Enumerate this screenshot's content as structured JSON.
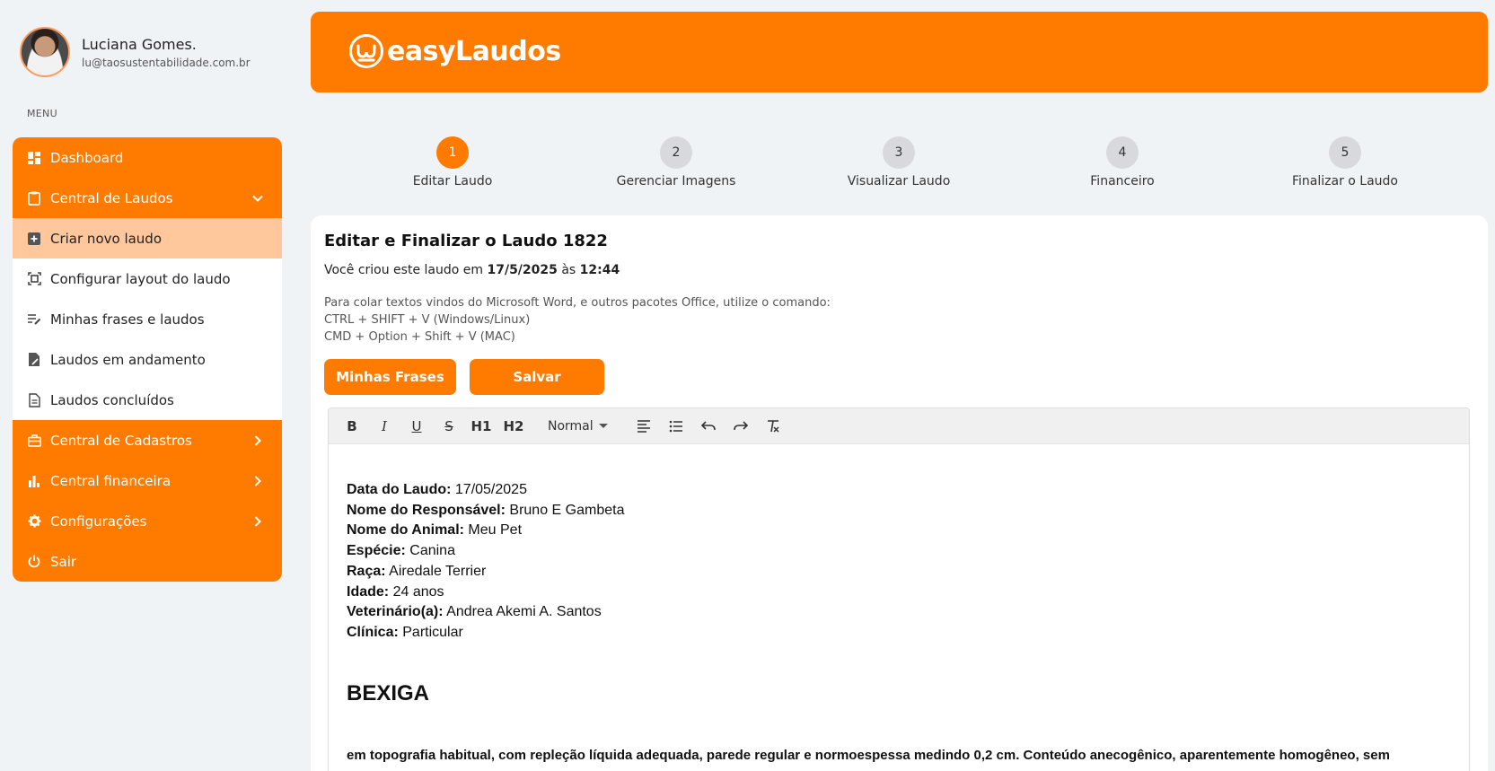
{
  "profile": {
    "name": "Luciana Gomes.",
    "email": "lu@taosustentabilidade.com.br"
  },
  "menu": {
    "caption": "MENU",
    "items": [
      {
        "label": "Dashboard",
        "icon": "dashboard-icon"
      },
      {
        "label": "Central de Laudos",
        "icon": "clipboard-icon"
      },
      {
        "label": "Criar novo laudo",
        "icon": "plus-square-icon"
      },
      {
        "label": "Configurar layout do laudo",
        "icon": "layout-icon"
      },
      {
        "label": "Minhas frases e laudos",
        "icon": "edit-list-icon"
      },
      {
        "label": "Laudos em andamento",
        "icon": "edit-document-icon"
      },
      {
        "label": "Laudos concluídos",
        "icon": "document-icon"
      },
      {
        "label": "Central de Cadastros",
        "icon": "briefcase-icon"
      },
      {
        "label": "Central financeira",
        "icon": "bar-chart-icon"
      },
      {
        "label": "Configurações",
        "icon": "gear-icon"
      },
      {
        "label": "Sair",
        "icon": "power-icon"
      }
    ]
  },
  "header": {
    "logo_text": "easyLaudos"
  },
  "stepper": [
    {
      "number": "1",
      "label": "Editar Laudo",
      "current": true
    },
    {
      "number": "2",
      "label": "Gerenciar Imagens",
      "current": false
    },
    {
      "number": "3",
      "label": "Visualizar Laudo",
      "current": false
    },
    {
      "number": "4",
      "label": "Financeiro",
      "current": false
    },
    {
      "number": "5",
      "label": "Finalizar o Laudo",
      "current": false
    }
  ],
  "card": {
    "title": "Editar e Finalizar o Laudo 1822",
    "created_prefix": "Você criou este laudo em",
    "created_date": "17/5/2025",
    "created_mid": "às",
    "created_time": "12:44",
    "tip_line1": "Para colar textos vindos do Microsoft Word, e outros pacotes Office, utilize o comando:",
    "tip_line2": "CTRL + SHIFT + V (Windows/Linux)",
    "tip_line3": "CMD + Option + Shift + V (MAC)",
    "btn_frases": "Minhas Frases",
    "btn_salvar": "Salvar"
  },
  "toolbar": {
    "bold": "B",
    "italic": "I",
    "underline": "U",
    "strike": "S",
    "h1": "H1",
    "h2": "H2",
    "format": "Normal"
  },
  "document": {
    "fields": [
      {
        "label": "Data do Laudo:",
        "value": "17/05/2025"
      },
      {
        "label": "Nome do Responsável:",
        "value": "Bruno E Gambeta"
      },
      {
        "label": "Nome do Animal:",
        "value": "Meu Pet"
      },
      {
        "label": "Espécie:",
        "value": "Canina"
      },
      {
        "label": "Raça:",
        "value": "Airedale Terrier"
      },
      {
        "label": "Idade:",
        "value": "24 anos"
      },
      {
        "label": "Veterinário(a):",
        "value": "Andrea Akemi A. Santos"
      },
      {
        "label": "Clínica:",
        "value": "Particular"
      }
    ],
    "section_title": "BEXIGA",
    "section_text": "em topografia habitual, com repleção líquida adequada, parede regular e normoespessa medindo 0,2 cm. Conteúdo anecogênico, aparentemente homogêneo, sem"
  },
  "colors": {
    "accent": "#ff7b00",
    "accent_light": "#ffc79b",
    "background": "#f0f3f6"
  }
}
